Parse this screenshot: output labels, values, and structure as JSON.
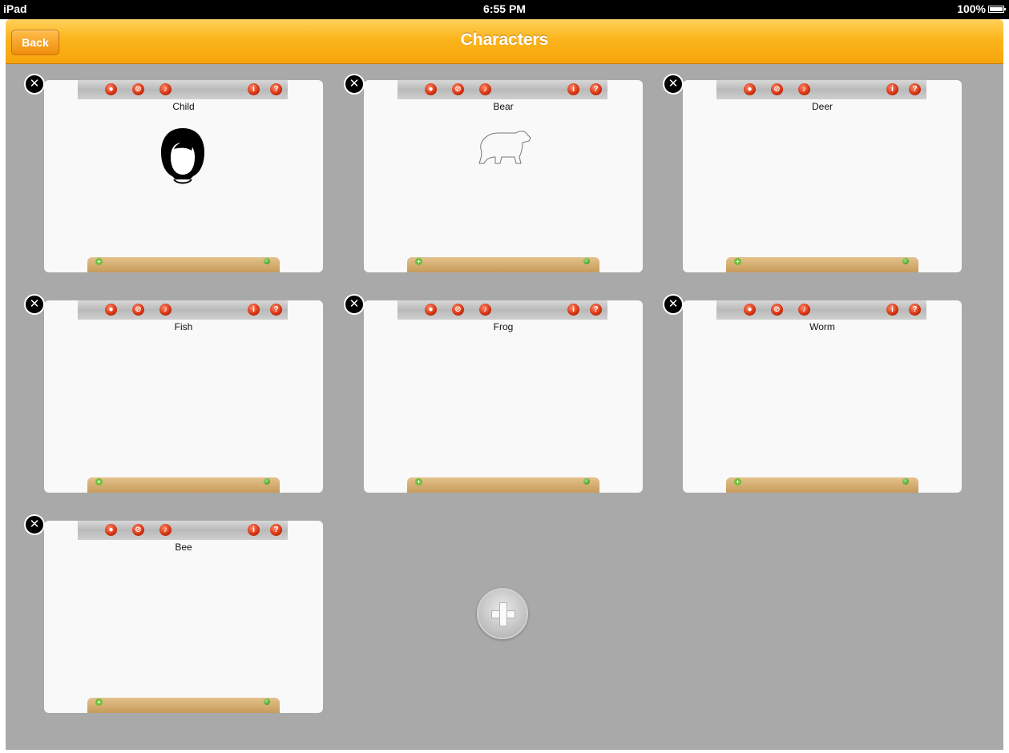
{
  "status_bar": {
    "carrier": "iPad",
    "time": "6:55 PM",
    "battery": "100%"
  },
  "nav": {
    "back_label": "Back",
    "title": "Characters"
  },
  "colors": {
    "accent": "#f6a50a",
    "background": "#a9a9a9"
  },
  "cards": [
    {
      "name": "Child",
      "image": "child-face"
    },
    {
      "name": "Bear",
      "image": "bear-outline"
    },
    {
      "name": "Deer",
      "image": ""
    },
    {
      "name": "Fish",
      "image": ""
    },
    {
      "name": "Frog",
      "image": ""
    },
    {
      "name": "Worm",
      "image": ""
    },
    {
      "name": "Bee",
      "image": ""
    }
  ],
  "icons": {
    "toolbar": [
      "record-icon",
      "edit-icon",
      "voice-icon",
      "info-icon",
      "help-icon"
    ],
    "delete": "close-icon",
    "add": "plus-icon"
  }
}
